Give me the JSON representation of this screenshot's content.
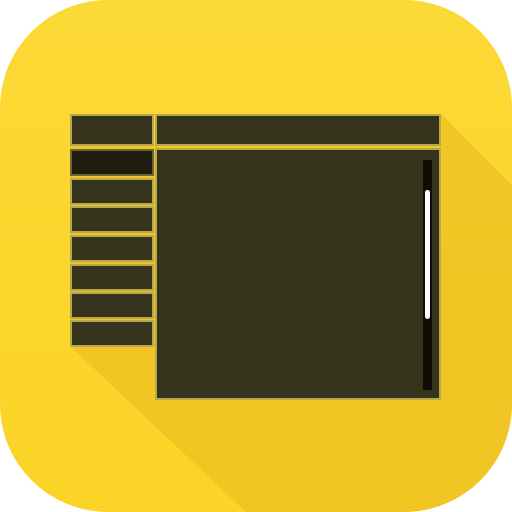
{
  "icon": {
    "name": "window-layout-icon",
    "background_color": "#fbd62c",
    "panel_color": "#36331c",
    "panel_border_color": "#b8a84a",
    "shadow_color": "#e8b61e",
    "scrollbar_color": "#ffffff"
  },
  "sidebar": {
    "items": [
      {
        "state": "selected"
      },
      {
        "state": "normal"
      },
      {
        "state": "normal"
      },
      {
        "state": "normal"
      },
      {
        "state": "normal"
      },
      {
        "state": "normal"
      },
      {
        "state": "normal"
      }
    ]
  },
  "main": {
    "scrollbar": {
      "thumb_start_fraction": 0.13,
      "thumb_size_fraction": 0.56
    }
  }
}
